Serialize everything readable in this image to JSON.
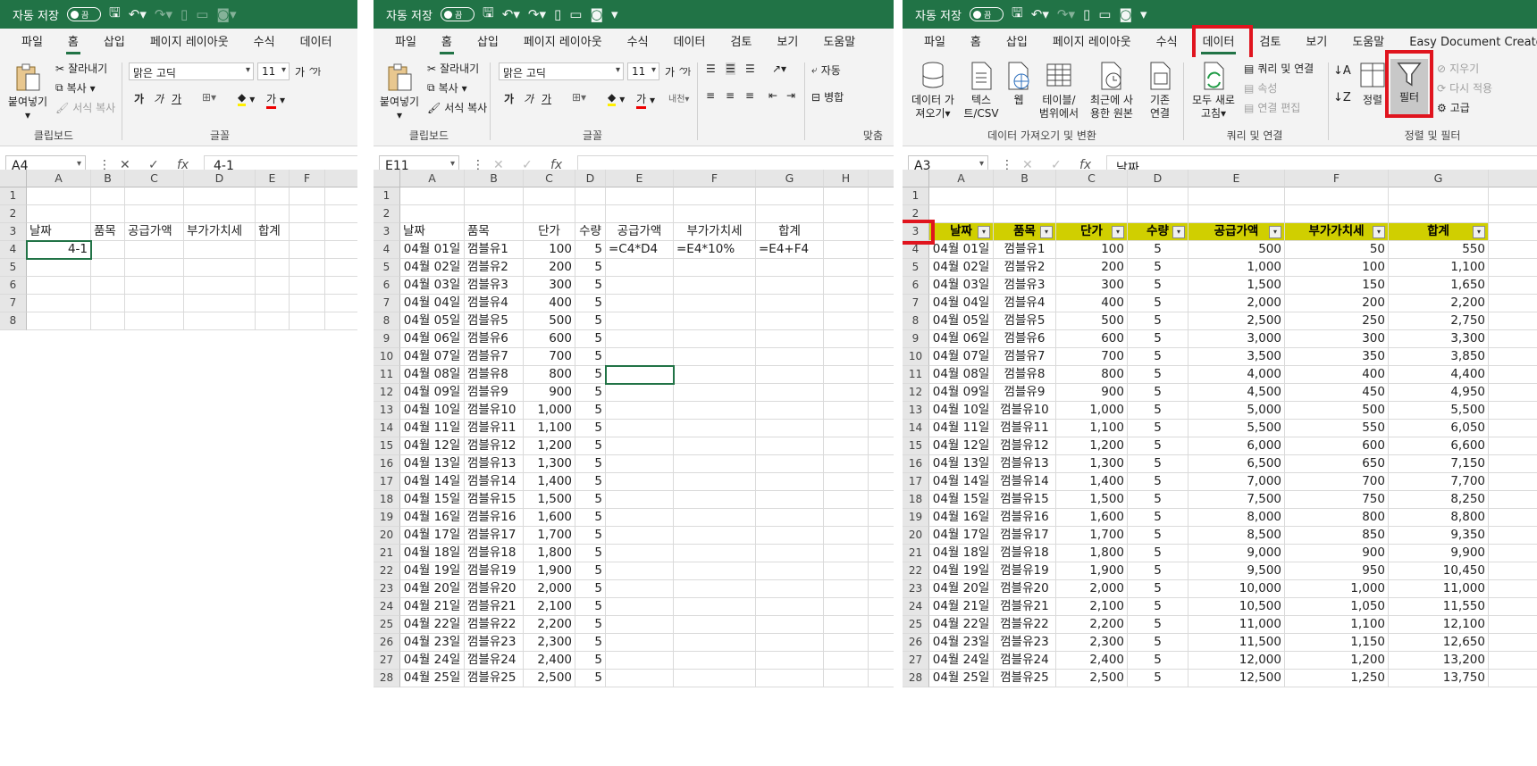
{
  "panel1": {
    "qa": {
      "autosave": "자동 저장",
      "toggle": "끔"
    },
    "tabs": [
      "파일",
      "홈",
      "삽입",
      "페이지 레이아웃",
      "수식",
      "데이터"
    ],
    "active_tab": "홈",
    "ribbon": {
      "paste": "붙여넣기",
      "cut": "잘라내기",
      "copy": "복사",
      "format_painter": "서식 복사",
      "font_name": "맑은 고딕",
      "font_size": "11",
      "group_clipboard": "클립보드",
      "group_font": "글꼴",
      "b": "가",
      "i": "가",
      "u": "가",
      "font_color": "가",
      "grow": "가",
      "shrink": "가"
    },
    "namebox": "A4",
    "formula": "4-1",
    "cols": [
      "A",
      "B",
      "C",
      "D",
      "E",
      "F"
    ],
    "rows": [
      "1",
      "2",
      "3",
      "4",
      "5",
      "6",
      "7"
    ],
    "row3": [
      "날짜",
      "품목",
      "공급가액",
      "부가가치세",
      "합계"
    ],
    "a4": "4-1"
  },
  "panel2": {
    "qa": {
      "autosave": "자동 저장",
      "toggle": "끔"
    },
    "tabs": [
      "파일",
      "홈",
      "삽입",
      "페이지 레이아웃",
      "수식",
      "데이터",
      "검토",
      "보기",
      "도움말"
    ],
    "active_tab": "홈",
    "ribbon": {
      "paste": "붙여넣기",
      "cut": "잘라내기",
      "copy": "복사",
      "format_painter": "서식 복사",
      "font_name": "맑은 고딕",
      "font_size": "11",
      "group_clipboard": "클립보드",
      "group_font": "글꼴",
      "group_align": "맞춤",
      "wrap": "자동",
      "merge": "병합",
      "b": "가",
      "i": "가",
      "u": "가",
      "font_color": "가",
      "grow": "가",
      "shrink": "가"
    },
    "namebox": "E11",
    "formula": "",
    "cols": [
      "A",
      "B",
      "C",
      "D",
      "E",
      "F",
      "G",
      "H"
    ],
    "header": [
      "날짜",
      "품목",
      "단가",
      "수량",
      "공급가액",
      "부가가치세",
      "합계"
    ],
    "formulas": [
      "=C4*D4",
      "=E4*10%",
      "=E4+F4"
    ],
    "rows": [
      [
        "04월 01일",
        "껌블유1",
        "100",
        "5"
      ],
      [
        "04월 02일",
        "껌블유2",
        "200",
        "5"
      ],
      [
        "04월 03일",
        "껌블유3",
        "300",
        "5"
      ],
      [
        "04월 04일",
        "껌블유4",
        "400",
        "5"
      ],
      [
        "04월 05일",
        "껌블유5",
        "500",
        "5"
      ],
      [
        "04월 06일",
        "껌블유6",
        "600",
        "5"
      ],
      [
        "04월 07일",
        "껌블유7",
        "700",
        "5"
      ],
      [
        "04월 08일",
        "껌블유8",
        "800",
        "5"
      ],
      [
        "04월 09일",
        "껌블유9",
        "900",
        "5"
      ],
      [
        "04월 10일",
        "껌블유10",
        "1,000",
        "5"
      ],
      [
        "04월 11일",
        "껌블유11",
        "1,100",
        "5"
      ],
      [
        "04월 12일",
        "껌블유12",
        "1,200",
        "5"
      ],
      [
        "04월 13일",
        "껌블유13",
        "1,300",
        "5"
      ],
      [
        "04월 14일",
        "껌블유14",
        "1,400",
        "5"
      ],
      [
        "04월 15일",
        "껌블유15",
        "1,500",
        "5"
      ],
      [
        "04월 16일",
        "껌블유16",
        "1,600",
        "5"
      ],
      [
        "04월 17일",
        "껌블유17",
        "1,700",
        "5"
      ],
      [
        "04월 18일",
        "껌블유18",
        "1,800",
        "5"
      ],
      [
        "04월 19일",
        "껌블유19",
        "1,900",
        "5"
      ],
      [
        "04월 20일",
        "껌블유20",
        "2,000",
        "5"
      ],
      [
        "04월 21일",
        "껌블유21",
        "2,100",
        "5"
      ],
      [
        "04월 22일",
        "껌블유22",
        "2,200",
        "5"
      ],
      [
        "04월 23일",
        "껌블유23",
        "2,300",
        "5"
      ],
      [
        "04월 24일",
        "껌블유24",
        "2,400",
        "5"
      ],
      [
        "04월 25일",
        "껌블유25",
        "2,500",
        "5"
      ]
    ]
  },
  "panel3": {
    "qa": {
      "autosave": "자동 저장",
      "toggle": "끔"
    },
    "tabs": [
      "파일",
      "홈",
      "삽입",
      "페이지 레이아웃",
      "수식",
      "데이터",
      "검토",
      "보기",
      "도움말",
      "Easy Document Creator"
    ],
    "active_tab": "데이터",
    "ribbon": {
      "get_data": "데이터 가\n져오기",
      "text_csv": "텍스\n트/CSV",
      "web": "웹",
      "table_range": "테이블/\n범위에서",
      "recent": "최근에 사\n용한 원본",
      "existing": "기존\n연결",
      "refresh_all": "모두 새로\n고침",
      "queries": "쿼리 및 연결",
      "properties": "속성",
      "edit_links": "연결 편집",
      "sort": "정렬",
      "filter": "필터",
      "clear": "지우기",
      "reapply": "다시 적용",
      "advanced": "고급",
      "group_get": "데이터 가져오기 및 변환",
      "group_query": "쿼리 및 연결",
      "group_sort": "정렬 및 필터"
    },
    "namebox": "A3",
    "formula": "날짜",
    "cols": [
      "A",
      "B",
      "C",
      "D",
      "E",
      "F",
      "G"
    ],
    "header": [
      "날짜",
      "품목",
      "단가",
      "수량",
      "공급가액",
      "부가가치세",
      "합계"
    ],
    "rows": [
      [
        "04월 01일",
        "껌블유1",
        "100",
        "5",
        "500",
        "50",
        "550"
      ],
      [
        "04월 02일",
        "껌블유2",
        "200",
        "5",
        "1,000",
        "100",
        "1,100"
      ],
      [
        "04월 03일",
        "껌블유3",
        "300",
        "5",
        "1,500",
        "150",
        "1,650"
      ],
      [
        "04월 04일",
        "껌블유4",
        "400",
        "5",
        "2,000",
        "200",
        "2,200"
      ],
      [
        "04월 05일",
        "껌블유5",
        "500",
        "5",
        "2,500",
        "250",
        "2,750"
      ],
      [
        "04월 06일",
        "껌블유6",
        "600",
        "5",
        "3,000",
        "300",
        "3,300"
      ],
      [
        "04월 07일",
        "껌블유7",
        "700",
        "5",
        "3,500",
        "350",
        "3,850"
      ],
      [
        "04월 08일",
        "껌블유8",
        "800",
        "5",
        "4,000",
        "400",
        "4,400"
      ],
      [
        "04월 09일",
        "껌블유9",
        "900",
        "5",
        "4,500",
        "450",
        "4,950"
      ],
      [
        "04월 10일",
        "껌블유10",
        "1,000",
        "5",
        "5,000",
        "500",
        "5,500"
      ],
      [
        "04월 11일",
        "껌블유11",
        "1,100",
        "5",
        "5,500",
        "550",
        "6,050"
      ],
      [
        "04월 12일",
        "껌블유12",
        "1,200",
        "5",
        "6,000",
        "600",
        "6,600"
      ],
      [
        "04월 13일",
        "껌블유13",
        "1,300",
        "5",
        "6,500",
        "650",
        "7,150"
      ],
      [
        "04월 14일",
        "껌블유14",
        "1,400",
        "5",
        "7,000",
        "700",
        "7,700"
      ],
      [
        "04월 15일",
        "껌블유15",
        "1,500",
        "5",
        "7,500",
        "750",
        "8,250"
      ],
      [
        "04월 16일",
        "껌블유16",
        "1,600",
        "5",
        "8,000",
        "800",
        "8,800"
      ],
      [
        "04월 17일",
        "껌블유17",
        "1,700",
        "5",
        "8,500",
        "850",
        "9,350"
      ],
      [
        "04월 18일",
        "껌블유18",
        "1,800",
        "5",
        "9,000",
        "900",
        "9,900"
      ],
      [
        "04월 19일",
        "껌블유19",
        "1,900",
        "5",
        "9,500",
        "950",
        "10,450"
      ],
      [
        "04월 20일",
        "껌블유20",
        "2,000",
        "5",
        "10,000",
        "1,000",
        "11,000"
      ],
      [
        "04월 21일",
        "껌블유21",
        "2,100",
        "5",
        "10,500",
        "1,050",
        "11,550"
      ],
      [
        "04월 22일",
        "껌블유22",
        "2,200",
        "5",
        "11,000",
        "1,100",
        "12,100"
      ],
      [
        "04월 23일",
        "껌블유23",
        "2,300",
        "5",
        "11,500",
        "1,150",
        "12,650"
      ],
      [
        "04월 24일",
        "껌블유24",
        "2,400",
        "5",
        "12,000",
        "1,200",
        "13,200"
      ],
      [
        "04월 25일",
        "껌블유25",
        "2,500",
        "5",
        "12,500",
        "1,250",
        "13,750"
      ]
    ]
  },
  "colors": {
    "excel_green": "#217346",
    "header_yellow": "#d0cf00",
    "highlight_red": "#e0141e"
  }
}
